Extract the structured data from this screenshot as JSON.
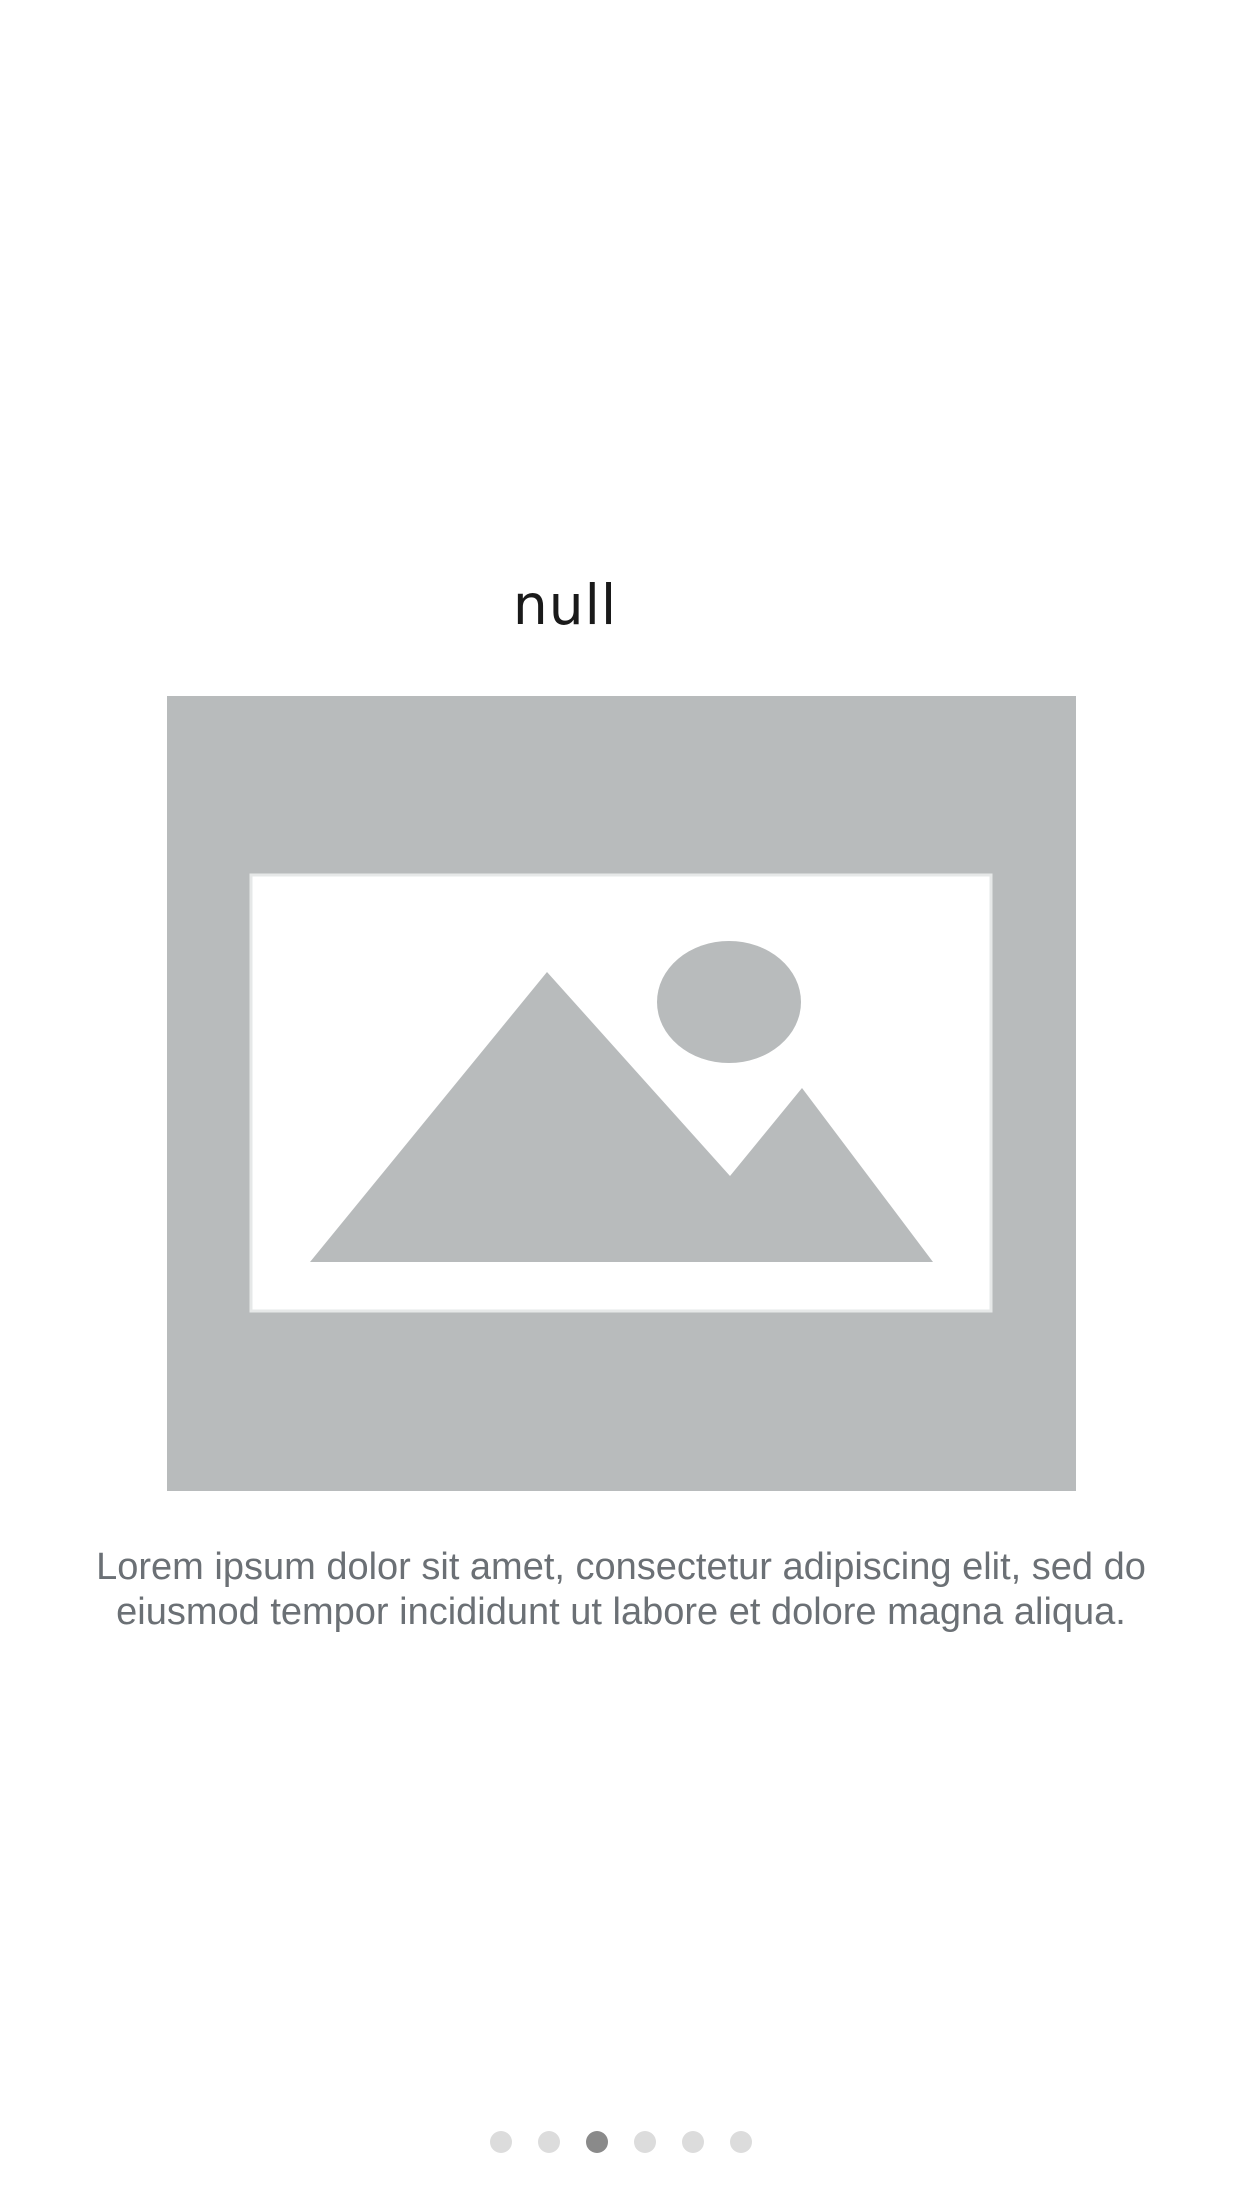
{
  "onboarding": {
    "title": "null",
    "image": {
      "icon": "image-placeholder-icon",
      "background_color": "#b8bbbc",
      "frame_color": "#ffffff"
    },
    "description": "Lorem ipsum dolor sit amet, consectetur adipiscing elit, sed do eiusmod tempor incididunt ut labore et dolore magna aliqua.",
    "pager": {
      "total": 6,
      "active_index": 2,
      "active_color": "#8a8a8a",
      "inactive_color": "#dcdcdc"
    }
  }
}
